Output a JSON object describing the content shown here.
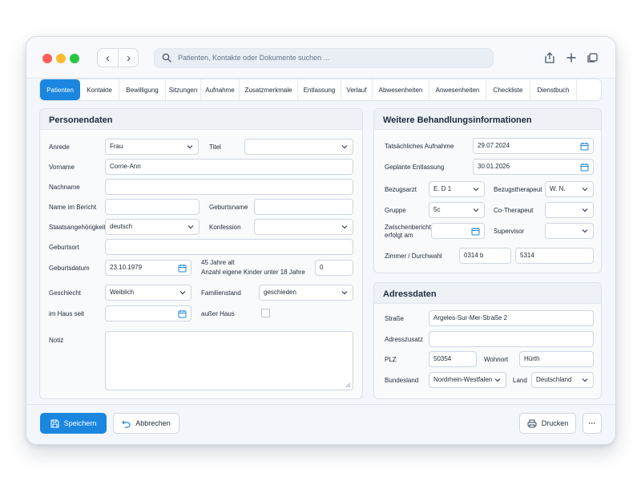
{
  "search": {
    "placeholder": "Patienten, Kontakte oder Dokumente suchen ..."
  },
  "tabs": [
    "Patienten",
    "Kontakte",
    "Bewilligung",
    "Sitzungen",
    "Aufnahme",
    "Zusatzmerkmale",
    "Entlassung",
    "Verlauf",
    "Abwesenheiten",
    "Anwesenheiten",
    "Checkliste",
    "Dienstbuch"
  ],
  "personal": {
    "title": "Personendaten",
    "anrede_label": "Anrede",
    "anrede_value": "Frau",
    "titel_label": "Titel",
    "titel_value": "",
    "vorname_label": "Vorname",
    "vorname_value": "Corrie-Ann",
    "nachname_label": "Nachname",
    "nachname_value": "",
    "bericht_label": "Name im Bericht",
    "bericht_value": "",
    "geburtsname_label": "Geburtsname",
    "geburtsname_value": "",
    "staat_label": "Staatsangehörigkeit",
    "staat_value": "deutsch",
    "konfession_label": "Konfession",
    "konfession_value": "",
    "geburtsort_label": "Geburtsort",
    "geburtsort_value": "",
    "geburtsdatum_label": "Geburtsdatum",
    "geburtsdatum_value": "23.10.1979",
    "age_text": "45 Jahre alt",
    "kinder_label": "Anzahl eigene Kinder unter 18 Jahre",
    "kinder_value": "0",
    "geschlecht_label": "Geschlecht",
    "geschlecht_value": "Weiblich",
    "familienstand_label": "Familienstand",
    "familienstand_value": "geschieden",
    "imhaus_label": "im Haus seit",
    "imhaus_value": "",
    "ausserhaus_label": "außer Haus",
    "notiz_label": "Notiz",
    "notiz_value": ""
  },
  "treatment": {
    "title": "Weitere Behandlungsinformationen",
    "aufnahme_label": "Tatsächliches Aufnahme",
    "aufnahme_value": "29.07.2024",
    "entlassung_label": "Geplante Entlassung",
    "entlassung_value": "30.01.2026",
    "arzt_label": "Bezugsarzt",
    "arzt_value": "E. D 1",
    "therapeut_label": "Bezugstherapeut",
    "therapeut_value": "W. N.",
    "gruppe_label": "Gruppe",
    "gruppe_value": "5c",
    "cotherapeut_label": "Co-Therapeut",
    "cotherapeut_value": "",
    "zwischen_label_1": "Zwischenbericht",
    "zwischen_label_2": "erfolgt am",
    "zwischen_value": "",
    "supervisor_label": "Supervisor",
    "supervisor_value": "",
    "zimmer_label": "Zimmer / Durchwahl",
    "zimmer_value": "0314 b",
    "durchwahl_value": "5314"
  },
  "address": {
    "title": "Adressdaten",
    "strasse_label": "Straße",
    "strasse_value": "Argeles-Sur-Mer-Straße 2",
    "zusatz_label": "Adresszusatz",
    "zusatz_value": "",
    "plz_label": "PLZ",
    "plz_value": "50354",
    "wohnort_label": "Wohnort",
    "wohnort_value": "Hürth",
    "bundesland_label": "Bundesland",
    "bundesland_value": "Nordrhein-Westfalen",
    "land_label": "Land",
    "land_value": "Deutschland"
  },
  "footer": {
    "save": "Speichern",
    "cancel": "Abbrechen",
    "print": "Drucken",
    "more": "···"
  },
  "colors": {
    "accent": "#1a86e0",
    "close": "#ff5f57",
    "minimize": "#febc2e",
    "zoom": "#28c840"
  }
}
